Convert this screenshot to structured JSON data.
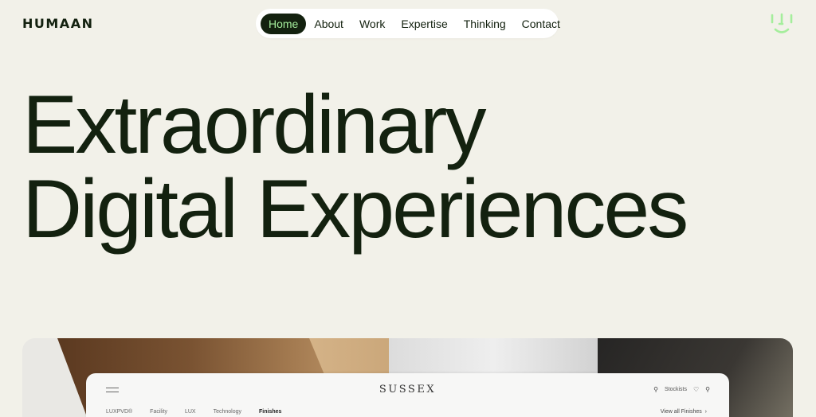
{
  "header": {
    "logo": "Humaan",
    "logo_display": "HUMAAN",
    "nav": [
      {
        "label": "Home",
        "active": true
      },
      {
        "label": "About",
        "active": false
      },
      {
        "label": "Work",
        "active": false
      },
      {
        "label": "Expertise",
        "active": false
      },
      {
        "label": "Thinking",
        "active": false
      },
      {
        "label": "Contact",
        "active": false
      }
    ],
    "face_icon": "smiley-face-icon",
    "accent_color": "#a5ee9c",
    "text_color": "#13210f"
  },
  "hero": {
    "line1": "Extraordinary",
    "line2": "Digital Experiences"
  },
  "showcase": {
    "brand": "SUSSEX",
    "menu_icon": "hamburger-menu-icon",
    "stockists_label": "Stockists",
    "stockists_icon": "location-pin-icon",
    "heart_icon": "heart-icon",
    "search_icon": "search-icon",
    "subnav": [
      {
        "label": "LUXPVD®",
        "current": false
      },
      {
        "label": "Facility",
        "current": false
      },
      {
        "label": "LUX",
        "current": false
      },
      {
        "label": "Technology",
        "current": false
      },
      {
        "label": "Finishes",
        "current": true
      }
    ],
    "view_all": "View all Finishes",
    "view_all_icon": "chevron-right-icon"
  }
}
